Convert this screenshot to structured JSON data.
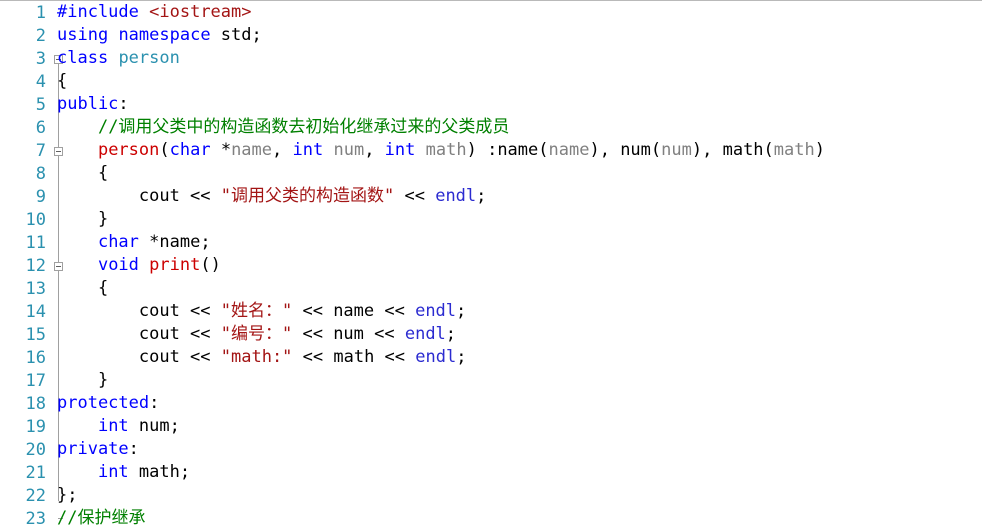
{
  "editor": {
    "name": "cpp-source-editor",
    "language": "C++",
    "line_count": 23,
    "colors": {
      "background": "#ffffff",
      "line_number": "#2b91af",
      "keyword": "#0000ff",
      "class_name": "#2b91af",
      "function_name": "#cc0000",
      "string": "#a31515",
      "comment": "#008000",
      "parameter": "#808080",
      "plain_text": "#000000",
      "fold_marker": "#a0a0a0"
    }
  },
  "gutter": {
    "line_numbers": [
      "1",
      "2",
      "3",
      "4",
      "5",
      "6",
      "7",
      "8",
      "9",
      "10",
      "11",
      "12",
      "13",
      "14",
      "15",
      "16",
      "17",
      "18",
      "19",
      "20",
      "21",
      "22",
      "23"
    ],
    "fold_markers": [
      {
        "line": 3,
        "state": "expanded",
        "glyph": "minus"
      },
      {
        "line": 7,
        "state": "expanded",
        "glyph": "minus"
      },
      {
        "line": 12,
        "state": "expanded",
        "glyph": "minus"
      }
    ]
  },
  "lines": [
    {
      "n": 1,
      "text": "#include <iostream>",
      "tokens": [
        {
          "t": "#include",
          "c": "pp"
        },
        {
          "t": " ",
          "c": "plain"
        },
        {
          "t": "<iostream>",
          "c": "hdr"
        }
      ]
    },
    {
      "n": 2,
      "text": "using namespace std;",
      "tokens": [
        {
          "t": "using",
          "c": "kw"
        },
        {
          "t": " ",
          "c": "plain"
        },
        {
          "t": "namespace",
          "c": "kw"
        },
        {
          "t": " std;",
          "c": "plain"
        }
      ]
    },
    {
      "n": 3,
      "text": "class person",
      "tokens": [
        {
          "t": "class",
          "c": "kw"
        },
        {
          "t": " ",
          "c": "plain"
        },
        {
          "t": "person",
          "c": "cls"
        }
      ]
    },
    {
      "n": 4,
      "text": "{",
      "tokens": [
        {
          "t": "{",
          "c": "plain"
        }
      ]
    },
    {
      "n": 5,
      "text": "public:",
      "tokens": [
        {
          "t": "public",
          "c": "kw"
        },
        {
          "t": ":",
          "c": "plain"
        }
      ]
    },
    {
      "n": 6,
      "text": "    //调用父类中的构造函数去初始化继承过来的父类成员",
      "tokens": [
        {
          "t": "    ",
          "c": "plain"
        },
        {
          "t": "//调用父类中的构造函数去初始化继承过来的父类成员",
          "c": "cmt"
        }
      ]
    },
    {
      "n": 7,
      "text": "    person(char *name, int num, int math) :name(name), num(num), math(math)",
      "tokens": [
        {
          "t": "    ",
          "c": "plain"
        },
        {
          "t": "person",
          "c": "fn"
        },
        {
          "t": "(",
          "c": "plain"
        },
        {
          "t": "char",
          "c": "kw"
        },
        {
          "t": " *",
          "c": "plain"
        },
        {
          "t": "name",
          "c": "param"
        },
        {
          "t": ", ",
          "c": "plain"
        },
        {
          "t": "int",
          "c": "kw"
        },
        {
          "t": " ",
          "c": "plain"
        },
        {
          "t": "num",
          "c": "param"
        },
        {
          "t": ", ",
          "c": "plain"
        },
        {
          "t": "int",
          "c": "kw"
        },
        {
          "t": " ",
          "c": "plain"
        },
        {
          "t": "math",
          "c": "param"
        },
        {
          "t": ") :",
          "c": "plain"
        },
        {
          "t": "name",
          "c": "plain"
        },
        {
          "t": "(",
          "c": "plain"
        },
        {
          "t": "name",
          "c": "param"
        },
        {
          "t": "), ",
          "c": "plain"
        },
        {
          "t": "num",
          "c": "plain"
        },
        {
          "t": "(",
          "c": "plain"
        },
        {
          "t": "num",
          "c": "param"
        },
        {
          "t": "), ",
          "c": "plain"
        },
        {
          "t": "math",
          "c": "plain"
        },
        {
          "t": "(",
          "c": "plain"
        },
        {
          "t": "math",
          "c": "param"
        },
        {
          "t": ")",
          "c": "plain"
        }
      ]
    },
    {
      "n": 8,
      "text": "    {",
      "tokens": [
        {
          "t": "    {",
          "c": "plain"
        }
      ]
    },
    {
      "n": 9,
      "text": "        cout << \"调用父类的构造函数\" << endl;",
      "tokens": [
        {
          "t": "        cout << ",
          "c": "plain"
        },
        {
          "t": "\"调用父类的构造函数\"",
          "c": "str"
        },
        {
          "t": " << ",
          "c": "plain"
        },
        {
          "t": "endl",
          "c": "endl"
        },
        {
          "t": ";",
          "c": "plain"
        }
      ]
    },
    {
      "n": 10,
      "text": "    }",
      "tokens": [
        {
          "t": "    }",
          "c": "plain"
        }
      ]
    },
    {
      "n": 11,
      "text": "    char *name;",
      "tokens": [
        {
          "t": "    ",
          "c": "plain"
        },
        {
          "t": "char",
          "c": "kw"
        },
        {
          "t": " *name;",
          "c": "plain"
        }
      ]
    },
    {
      "n": 12,
      "text": "    void print()",
      "tokens": [
        {
          "t": "    ",
          "c": "plain"
        },
        {
          "t": "void",
          "c": "kw"
        },
        {
          "t": " ",
          "c": "plain"
        },
        {
          "t": "print",
          "c": "fn"
        },
        {
          "t": "()",
          "c": "plain"
        }
      ]
    },
    {
      "n": 13,
      "text": "    {",
      "tokens": [
        {
          "t": "    {",
          "c": "plain"
        }
      ]
    },
    {
      "n": 14,
      "text": "        cout << \"姓名：\" << name << endl;",
      "tokens": [
        {
          "t": "        cout << ",
          "c": "plain"
        },
        {
          "t": "\"姓名：\"",
          "c": "str"
        },
        {
          "t": " << name << ",
          "c": "plain"
        },
        {
          "t": "endl",
          "c": "endl"
        },
        {
          "t": ";",
          "c": "plain"
        }
      ]
    },
    {
      "n": 15,
      "text": "        cout << \"编号：\" << num << endl;",
      "tokens": [
        {
          "t": "        cout << ",
          "c": "plain"
        },
        {
          "t": "\"编号：\"",
          "c": "str"
        },
        {
          "t": " << num << ",
          "c": "plain"
        },
        {
          "t": "endl",
          "c": "endl"
        },
        {
          "t": ";",
          "c": "plain"
        }
      ]
    },
    {
      "n": 16,
      "text": "        cout << \"math:\" << math << endl;",
      "tokens": [
        {
          "t": "        cout << ",
          "c": "plain"
        },
        {
          "t": "\"math:\"",
          "c": "str"
        },
        {
          "t": " << math << ",
          "c": "plain"
        },
        {
          "t": "endl",
          "c": "endl"
        },
        {
          "t": ";",
          "c": "plain"
        }
      ]
    },
    {
      "n": 17,
      "text": "    }",
      "tokens": [
        {
          "t": "    }",
          "c": "plain"
        }
      ]
    },
    {
      "n": 18,
      "text": "protected:",
      "tokens": [
        {
          "t": "protected",
          "c": "kw"
        },
        {
          "t": ":",
          "c": "plain"
        }
      ]
    },
    {
      "n": 19,
      "text": "    int num;",
      "tokens": [
        {
          "t": "    ",
          "c": "plain"
        },
        {
          "t": "int",
          "c": "kw"
        },
        {
          "t": " num;",
          "c": "plain"
        }
      ]
    },
    {
      "n": 20,
      "text": "private:",
      "tokens": [
        {
          "t": "private",
          "c": "kw"
        },
        {
          "t": ":",
          "c": "plain"
        }
      ]
    },
    {
      "n": 21,
      "text": "    int math;",
      "tokens": [
        {
          "t": "    ",
          "c": "plain"
        },
        {
          "t": "int",
          "c": "kw"
        },
        {
          "t": " math;",
          "c": "plain"
        }
      ]
    },
    {
      "n": 22,
      "text": "};",
      "tokens": [
        {
          "t": "};",
          "c": "plain"
        }
      ]
    },
    {
      "n": 23,
      "text": "//保护继承",
      "tokens": [
        {
          "t": "//保护继承",
          "c": "cmt"
        }
      ]
    }
  ]
}
